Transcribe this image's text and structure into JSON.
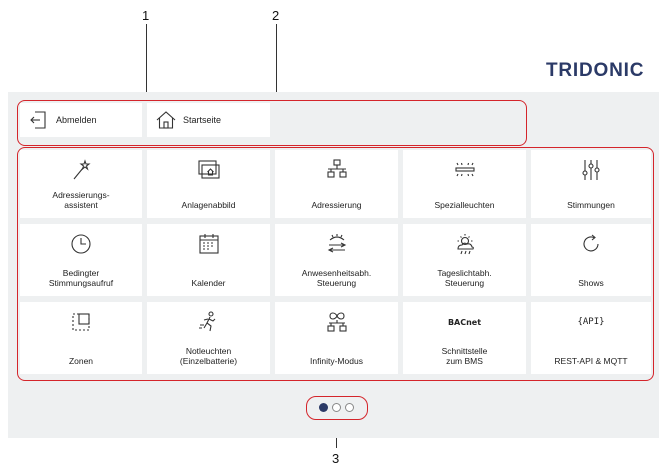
{
  "callouts": {
    "one": "1",
    "two": "2",
    "three": "3"
  },
  "brand": "TRIDONIC",
  "top_bar": {
    "logout_label": "Abmelden",
    "home_label": "Startseite"
  },
  "tiles": [
    {
      "label": "Adressierungs-\nassistent",
      "icon": "magic-wand-icon"
    },
    {
      "label": "Anlagenabbild",
      "icon": "installation-image-icon"
    },
    {
      "label": "Adressierung",
      "icon": "network-addressing-icon"
    },
    {
      "label": "Spezialleuchten",
      "icon": "special-luminaire-icon"
    },
    {
      "label": "Stimmungen",
      "icon": "sliders-icon"
    },
    {
      "label": "Bedingter\nStimmungsaufruf",
      "icon": "clock-icon"
    },
    {
      "label": "Kalender",
      "icon": "calendar-icon"
    },
    {
      "label": "Anwesenheitsabh.\nSteuerung",
      "icon": "presence-icon"
    },
    {
      "label": "Tageslichtabh.\nSteuerung",
      "icon": "daylight-icon"
    },
    {
      "label": "Shows",
      "icon": "refresh-circle-icon"
    },
    {
      "label": "Zonen",
      "icon": "zones-icon"
    },
    {
      "label": "Notleuchten\n(Einzelbatterie)",
      "icon": "emergency-exit-icon"
    },
    {
      "label": "Infinity-Modus",
      "icon": "infinity-network-icon"
    },
    {
      "label": "Schnittstelle\nzum BMS",
      "icon": "bacnet-icon",
      "icon_text": "BACnet"
    },
    {
      "label": "REST-API & MQTT",
      "icon": "api-icon",
      "icon_text": "{API}"
    }
  ],
  "pagination": {
    "pages": 3,
    "current": 1
  },
  "colors": {
    "brand": "#2b3a67",
    "callout_frame": "#d4252b",
    "panel": "#eef0f1",
    "active_dot": "#2b3a67"
  }
}
